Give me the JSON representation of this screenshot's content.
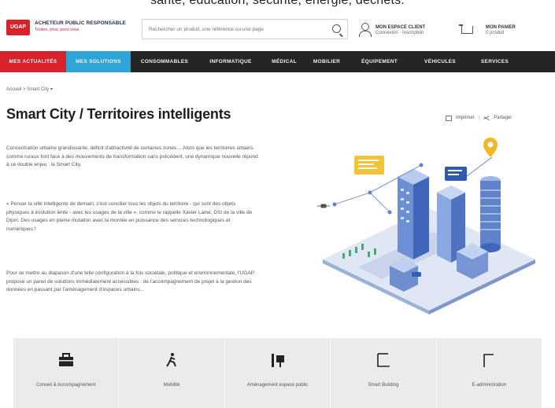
{
  "top_strip": {
    "text": "santé, éducation, sécurité, énergie, déchets."
  },
  "header": {
    "logo_text": "UGAP",
    "brand_line1": "ACHETEUR PUBLIC RESPONSABLE",
    "brand_line2": "Toutes, plus, pour vous",
    "search_placeholder": "Rechercher un produit, une référence ou une page",
    "account_line1": "MON ESPACE CLIENT",
    "account_line2": "Connexion · Inscription",
    "cart_line1": "MON PANIER",
    "cart_line2": "0 produit"
  },
  "nav": {
    "items": [
      {
        "label": "MES ACTUALITÉS"
      },
      {
        "label": "MES SOLUTIONS"
      },
      {
        "label": "CONSOMMABLES"
      },
      {
        "label": "INFORMATIQUE"
      },
      {
        "label": "MÉDICAL"
      },
      {
        "label": "MOBILIER"
      },
      {
        "label": "ÉQUIPEMENT"
      },
      {
        "label": "VÉHICULES"
      },
      {
        "label": "SERVICES"
      }
    ]
  },
  "breadcrumb": "Accueil > Smart City ▾",
  "page": {
    "title": "Smart City / Territoires intelligents",
    "print_label": "Imprimer",
    "share_label": "Partager",
    "p1": "Concentration urbaine grandissante, déficit d'attractivité de certaines zones… Alors que les territoires urbains comme ruraux font face à des mouvements de transformation sans précédent, une dynamique nouvelle répond à ce double enjeu : la Smart City.",
    "p2": "« Penser la ville intelligente de demain, c'est concilier tous les objets du territoire - qui sont des objets physiques à évolution lente - avec les usages de la ville », comme le rappelle Xavier Lainé, DSI de la ville de Dijon. Des usages en pleine mutation avec la montée en puissance des services technologiques et numériques !",
    "p3": "Pour se mettre au diapason d'une telle configuration à la fois sociétale, politique et environnementale, l'UGAP propose un panel de solutions immédiatement accessibles : de l'accompagnement de projet à la gestion des données en passant par l'aménagement d'espaces urbains…"
  },
  "solutions": [
    {
      "label": "Conseil & Accompagnement",
      "icon": "briefcase-icon"
    },
    {
      "label": "Mobilité",
      "icon": "walking-person-icon"
    },
    {
      "label": "Aménagement espace public",
      "icon": "street-furniture-icon"
    },
    {
      "label": "Smart Building",
      "icon": "building-icon"
    },
    {
      "label": "E-administration",
      "icon": "screen-icon"
    }
  ],
  "colors": {
    "brand_red": "#d6232c",
    "nav_dark": "#242526",
    "nav_active_blue": "#2da6d6",
    "solutions_bg": "#ebebeb"
  }
}
